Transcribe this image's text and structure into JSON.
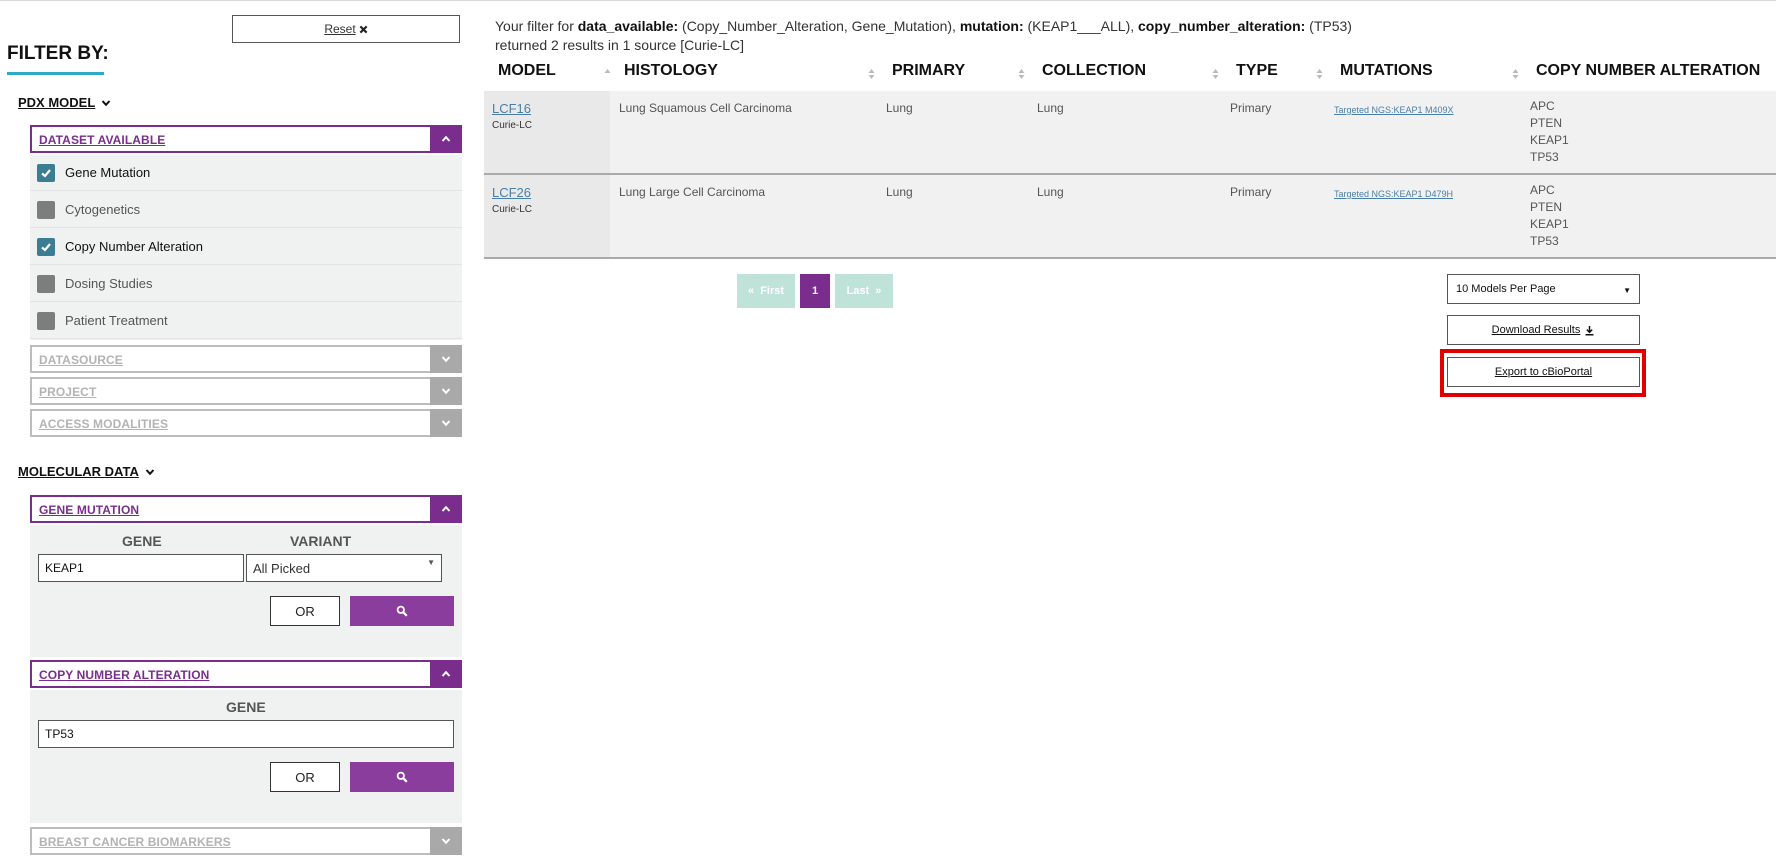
{
  "sidebar": {
    "reset_label": "Reset",
    "title": "FILTER BY:",
    "pdx_model": {
      "label": "PDX MODEL",
      "dataset_available": {
        "label": "DATASET AVAILABLE",
        "options": [
          {
            "label": "Gene Mutation",
            "checked": true
          },
          {
            "label": "Cytogenetics",
            "checked": false
          },
          {
            "label": "Copy Number Alteration",
            "checked": true
          },
          {
            "label": "Dosing Studies",
            "checked": false
          },
          {
            "label": "Patient Treatment",
            "checked": false
          }
        ]
      },
      "datasource_label": "DATASOURCE",
      "project_label": "PROJECT",
      "access_label": "ACCESS MODALITIES"
    },
    "molecular_data": {
      "label": "MOLECULAR DATA",
      "gene_mutation": {
        "label": "GENE MUTATION",
        "gene_col": "GENE",
        "variant_col": "VARIANT",
        "gene_value": "KEAP1",
        "variant_value": "All Picked",
        "or_label": "OR"
      },
      "copy_number": {
        "label": "COPY NUMBER ALTERATION",
        "gene_col": "GENE",
        "gene_value": "TP53",
        "or_label": "OR"
      },
      "breast_label": "BREAST CANCER BIOMARKERS"
    }
  },
  "summary": {
    "prefix": "Your filter for",
    "k1": "data_available:",
    "v1": "(Copy_Number_Alteration, Gene_Mutation),",
    "k2": "mutation:",
    "v2": "(KEAP1___ALL),",
    "k3": "copy_number_alteration:",
    "v3": "(TP53)",
    "line2": "returned 2 results in 1 source [Curie-LC]"
  },
  "table": {
    "columns": [
      "MODEL",
      "HISTOLOGY",
      "PRIMARY",
      "COLLECTION",
      "TYPE",
      "MUTATIONS",
      "COPY NUMBER ALTERATION"
    ],
    "rows": [
      {
        "model": "LCF16",
        "source": "Curie-LC",
        "histology": "Lung Squamous Cell Carcinoma",
        "primary": "Lung",
        "collection": "Lung",
        "type": "Primary",
        "mutation": "Targeted NGS:KEAP1 M409X",
        "cna": [
          "APC",
          "PTEN",
          "KEAP1",
          "TP53"
        ]
      },
      {
        "model": "LCF26",
        "source": "Curie-LC",
        "histology": "Lung Large Cell Carcinoma",
        "primary": "Lung",
        "collection": "Lung",
        "type": "Primary",
        "mutation": "Targeted NGS:KEAP1 D479H",
        "cna": [
          "APC",
          "PTEN",
          "KEAP1",
          "TP53"
        ]
      }
    ]
  },
  "pagination": {
    "first": "First",
    "current": "1",
    "last": "Last"
  },
  "controls": {
    "per_page": "10 Models Per Page",
    "download": "Download Results",
    "export": "Export to cBioPortal"
  },
  "colors": {
    "accent": "#7b2d8e",
    "link": "#4a7fa6",
    "highlight": "#e00000",
    "checked": "#3b7d93"
  }
}
